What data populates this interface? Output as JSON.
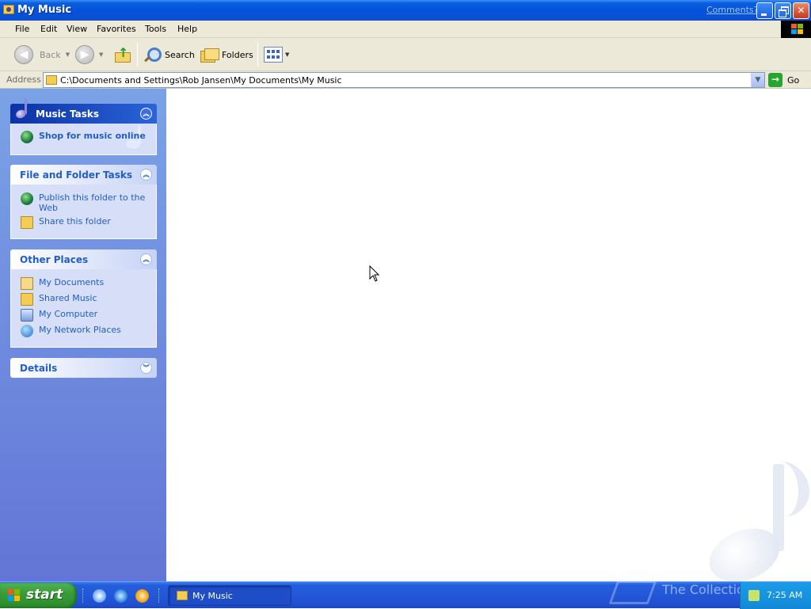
{
  "window": {
    "title": "My Music",
    "comments_link": "Comments?"
  },
  "menu": [
    "File",
    "Edit",
    "View",
    "Favorites",
    "Tools",
    "Help"
  ],
  "toolbar": {
    "back": "Back",
    "search": "Search",
    "folders": "Folders"
  },
  "address": {
    "label": "Address",
    "path": "C:\\Documents and Settings\\Rob Jansen\\My Documents\\My Music",
    "go": "Go"
  },
  "taskpane": {
    "music_tasks": {
      "title": "Music Tasks",
      "items": [
        "Shop for music online"
      ]
    },
    "file_folder_tasks": {
      "title": "File and Folder Tasks",
      "items": [
        "Publish this folder to the Web",
        "Share this folder"
      ]
    },
    "other_places": {
      "title": "Other Places",
      "items": [
        "My Documents",
        "Shared Music",
        "My Computer",
        "My Network Places"
      ]
    },
    "details": {
      "title": "Details"
    }
  },
  "taskbar": {
    "start": "start",
    "window_button": "My Music",
    "clock": "7:25 AM",
    "watermark": "The Collection Book"
  },
  "icons": {
    "folder": "folder-icon",
    "music": "music-note-icon",
    "globe": "globe-icon"
  }
}
